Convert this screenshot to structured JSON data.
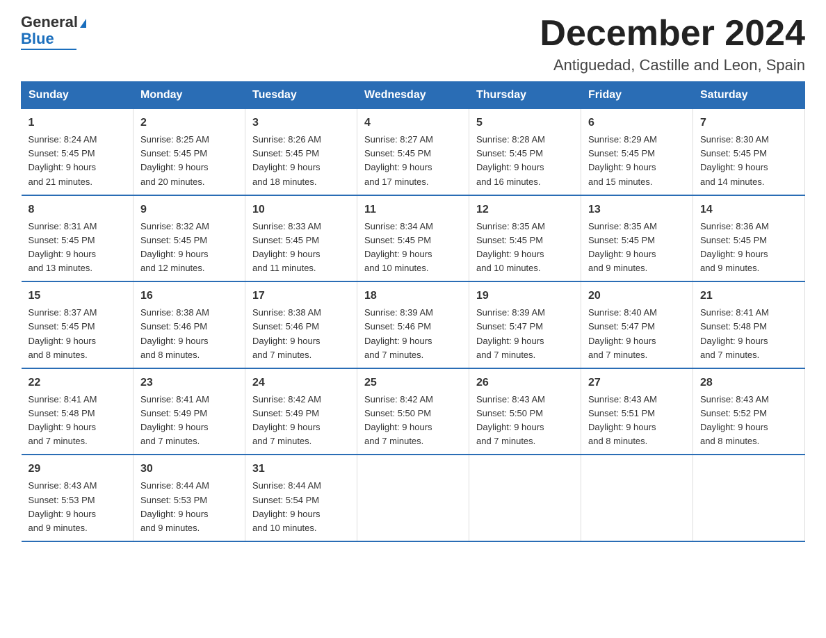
{
  "logo": {
    "line1": "General",
    "triangle": "▶",
    "line2": "Blue"
  },
  "title": "December 2024",
  "subtitle": "Antiguedad, Castille and Leon, Spain",
  "days_header": [
    "Sunday",
    "Monday",
    "Tuesday",
    "Wednesday",
    "Thursday",
    "Friday",
    "Saturday"
  ],
  "weeks": [
    [
      {
        "day": "1",
        "sunrise": "8:24 AM",
        "sunset": "5:45 PM",
        "daylight": "9 hours and 21 minutes."
      },
      {
        "day": "2",
        "sunrise": "8:25 AM",
        "sunset": "5:45 PM",
        "daylight": "9 hours and 20 minutes."
      },
      {
        "day": "3",
        "sunrise": "8:26 AM",
        "sunset": "5:45 PM",
        "daylight": "9 hours and 18 minutes."
      },
      {
        "day": "4",
        "sunrise": "8:27 AM",
        "sunset": "5:45 PM",
        "daylight": "9 hours and 17 minutes."
      },
      {
        "day": "5",
        "sunrise": "8:28 AM",
        "sunset": "5:45 PM",
        "daylight": "9 hours and 16 minutes."
      },
      {
        "day": "6",
        "sunrise": "8:29 AM",
        "sunset": "5:45 PM",
        "daylight": "9 hours and 15 minutes."
      },
      {
        "day": "7",
        "sunrise": "8:30 AM",
        "sunset": "5:45 PM",
        "daylight": "9 hours and 14 minutes."
      }
    ],
    [
      {
        "day": "8",
        "sunrise": "8:31 AM",
        "sunset": "5:45 PM",
        "daylight": "9 hours and 13 minutes."
      },
      {
        "day": "9",
        "sunrise": "8:32 AM",
        "sunset": "5:45 PM",
        "daylight": "9 hours and 12 minutes."
      },
      {
        "day": "10",
        "sunrise": "8:33 AM",
        "sunset": "5:45 PM",
        "daylight": "9 hours and 11 minutes."
      },
      {
        "day": "11",
        "sunrise": "8:34 AM",
        "sunset": "5:45 PM",
        "daylight": "9 hours and 10 minutes."
      },
      {
        "day": "12",
        "sunrise": "8:35 AM",
        "sunset": "5:45 PM",
        "daylight": "9 hours and 10 minutes."
      },
      {
        "day": "13",
        "sunrise": "8:35 AM",
        "sunset": "5:45 PM",
        "daylight": "9 hours and 9 minutes."
      },
      {
        "day": "14",
        "sunrise": "8:36 AM",
        "sunset": "5:45 PM",
        "daylight": "9 hours and 9 minutes."
      }
    ],
    [
      {
        "day": "15",
        "sunrise": "8:37 AM",
        "sunset": "5:45 PM",
        "daylight": "9 hours and 8 minutes."
      },
      {
        "day": "16",
        "sunrise": "8:38 AM",
        "sunset": "5:46 PM",
        "daylight": "9 hours and 8 minutes."
      },
      {
        "day": "17",
        "sunrise": "8:38 AM",
        "sunset": "5:46 PM",
        "daylight": "9 hours and 7 minutes."
      },
      {
        "day": "18",
        "sunrise": "8:39 AM",
        "sunset": "5:46 PM",
        "daylight": "9 hours and 7 minutes."
      },
      {
        "day": "19",
        "sunrise": "8:39 AM",
        "sunset": "5:47 PM",
        "daylight": "9 hours and 7 minutes."
      },
      {
        "day": "20",
        "sunrise": "8:40 AM",
        "sunset": "5:47 PM",
        "daylight": "9 hours and 7 minutes."
      },
      {
        "day": "21",
        "sunrise": "8:41 AM",
        "sunset": "5:48 PM",
        "daylight": "9 hours and 7 minutes."
      }
    ],
    [
      {
        "day": "22",
        "sunrise": "8:41 AM",
        "sunset": "5:48 PM",
        "daylight": "9 hours and 7 minutes."
      },
      {
        "day": "23",
        "sunrise": "8:41 AM",
        "sunset": "5:49 PM",
        "daylight": "9 hours and 7 minutes."
      },
      {
        "day": "24",
        "sunrise": "8:42 AM",
        "sunset": "5:49 PM",
        "daylight": "9 hours and 7 minutes."
      },
      {
        "day": "25",
        "sunrise": "8:42 AM",
        "sunset": "5:50 PM",
        "daylight": "9 hours and 7 minutes."
      },
      {
        "day": "26",
        "sunrise": "8:43 AM",
        "sunset": "5:50 PM",
        "daylight": "9 hours and 7 minutes."
      },
      {
        "day": "27",
        "sunrise": "8:43 AM",
        "sunset": "5:51 PM",
        "daylight": "9 hours and 8 minutes."
      },
      {
        "day": "28",
        "sunrise": "8:43 AM",
        "sunset": "5:52 PM",
        "daylight": "9 hours and 8 minutes."
      }
    ],
    [
      {
        "day": "29",
        "sunrise": "8:43 AM",
        "sunset": "5:53 PM",
        "daylight": "9 hours and 9 minutes."
      },
      {
        "day": "30",
        "sunrise": "8:44 AM",
        "sunset": "5:53 PM",
        "daylight": "9 hours and 9 minutes."
      },
      {
        "day": "31",
        "sunrise": "8:44 AM",
        "sunset": "5:54 PM",
        "daylight": "9 hours and 10 minutes."
      },
      null,
      null,
      null,
      null
    ]
  ],
  "labels": {
    "sunrise": "Sunrise:",
    "sunset": "Sunset:",
    "daylight": "Daylight:"
  }
}
